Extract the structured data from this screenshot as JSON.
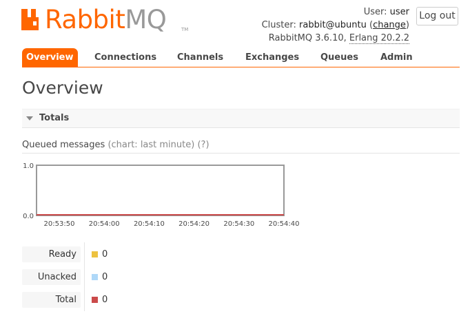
{
  "brand": {
    "name_primary": "Rabbit",
    "name_secondary": "MQ",
    "trademark": "TM",
    "colors": {
      "orange": "#ff6600",
      "grey": "#999999"
    }
  },
  "header": {
    "user_label": "User:",
    "user_value": "user",
    "cluster_label": "Cluster:",
    "cluster_value": "rabbit@ubuntu",
    "change_link": "change",
    "version": "RabbitMQ 3.6.10,",
    "erlang": "Erlang 20.2.2",
    "logout": "Log out"
  },
  "tabs": [
    {
      "label": "Overview",
      "active": true
    },
    {
      "label": "Connections",
      "active": false
    },
    {
      "label": "Channels",
      "active": false
    },
    {
      "label": "Exchanges",
      "active": false
    },
    {
      "label": "Queues",
      "active": false
    },
    {
      "label": "Admin",
      "active": false
    }
  ],
  "page": {
    "title": "Overview",
    "section": "Totals",
    "chart_heading": "Queued messages",
    "chart_range": "(chart: last minute)",
    "help": "(?)"
  },
  "chart_data": {
    "type": "area",
    "x": [
      "20:53:50",
      "20:54:00",
      "20:54:10",
      "20:54:20",
      "20:54:30",
      "20:54:40"
    ],
    "y_ticks": [
      "1.0",
      "0.0"
    ],
    "ylim": [
      0,
      1
    ],
    "series": [
      {
        "name": "Ready",
        "color": "#edc240",
        "values": [
          0,
          0,
          0,
          0,
          0,
          0
        ]
      },
      {
        "name": "Unacked",
        "color": "#afd8f8",
        "values": [
          0,
          0,
          0,
          0,
          0,
          0
        ]
      },
      {
        "name": "Total",
        "color": "#cb4b4b",
        "values": [
          0,
          0,
          0,
          0,
          0,
          0
        ]
      }
    ]
  },
  "legend": [
    {
      "label": "Ready",
      "value": "0",
      "color": "#edc240"
    },
    {
      "label": "Unacked",
      "value": "0",
      "color": "#afd8f8"
    },
    {
      "label": "Total",
      "value": "0",
      "color": "#cb4b4b"
    }
  ]
}
